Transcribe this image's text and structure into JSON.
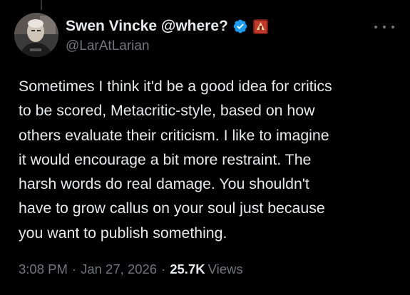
{
  "author": {
    "display_name": "Swen Vincke @where?",
    "handle": "@LarAtLarian",
    "verified_color": "#1d9bf0"
  },
  "tweet": {
    "text": "Sometimes I think it'd be a good idea for critics\nto be scored, Metacritic-style, based on how\nothers evaluate their criticism. I like to imagine\nit would encourage a bit more restraint. The\nharsh words do real damage. You shouldn't\nhave to grow callus on your soul just because\nyou want  to publish something.",
    "time": "3:08 PM",
    "date": "Jan 27, 2026",
    "separator": "·",
    "views_count": "25.7K",
    "views_label": "Views"
  },
  "icons": {
    "avatar": "avatar",
    "verified": "verified-badge-icon",
    "affiliate": "affiliate-badge-icon",
    "more": "more-options-icon"
  },
  "colors": {
    "background": "#000000",
    "text_primary": "#e7e9ea",
    "text_secondary": "#71767b",
    "accent": "#1d9bf0"
  }
}
